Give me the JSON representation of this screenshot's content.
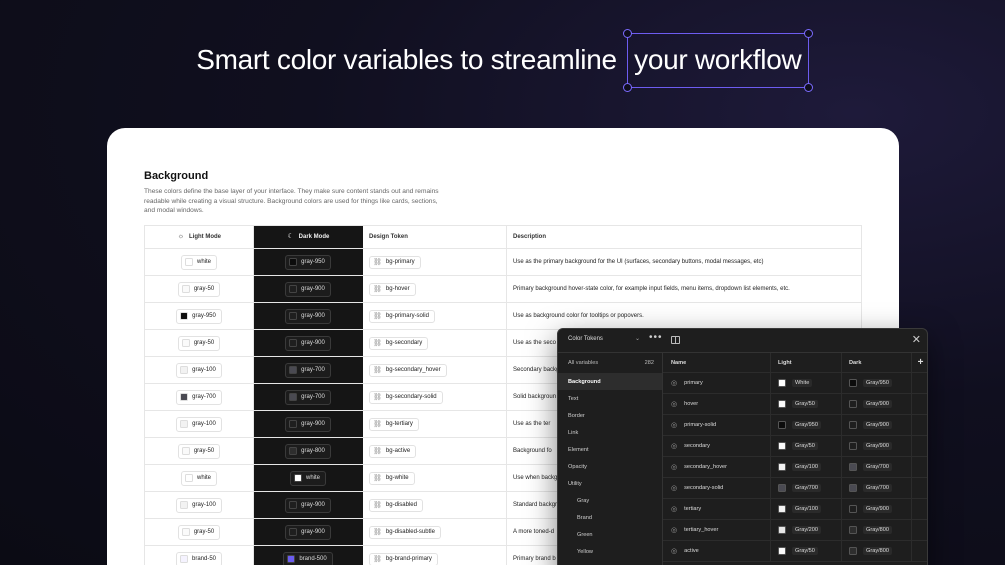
{
  "headline": {
    "before": "Smart color variables to streamline",
    "highlight": "your workflow"
  },
  "section": {
    "title": "Background",
    "description": "These colors define the base layer of your interface. They make sure content stands out and remains readable while creating a visual structure. Background colors are used for things like cards, sections, and modal windows."
  },
  "table": {
    "headers": {
      "light": "Light Mode",
      "dark": "Dark Mode",
      "token": "Design Token",
      "description": "Description"
    },
    "icons": {
      "light": "sun-icon",
      "dark": "moon-icon",
      "token": "link-icon"
    },
    "rows": [
      {
        "light": "white",
        "light_color": "#ffffff",
        "dark": "gray-950",
        "dark_color": "#0c0c0c",
        "token": "bg-primary",
        "description": "Use as the primary background for the UI (surfaces, secondary buttons, modal messages, etc)"
      },
      {
        "light": "gray-50",
        "light_color": "#fafafa",
        "dark": "gray-900",
        "dark_color": "#1f1f1f",
        "token": "bg-hover",
        "description": "Primary background hover-state color, for example input fields, menu items, dropdown list elements, etc."
      },
      {
        "light": "gray-950",
        "light_color": "#0c0c0c",
        "dark": "gray-900",
        "dark_color": "#1f1f1f",
        "token": "bg-primary-solid",
        "description": "Use as background color for tooltips or popovers."
      },
      {
        "light": "gray-50",
        "light_color": "#fafafa",
        "dark": "gray-900",
        "dark_color": "#1f1f1f",
        "token": "bg-secondary",
        "description": "Use as the seco"
      },
      {
        "light": "gray-100",
        "light_color": "#f2f2f2",
        "dark": "gray-700",
        "dark_color": "#4a4a52",
        "token": "bg-secondary_hover",
        "description": "Secondary backgr"
      },
      {
        "light": "gray-700",
        "light_color": "#4a4a52",
        "dark": "gray-700",
        "dark_color": "#4a4a52",
        "token": "bg-secondary-solid",
        "description": "Solid backgroun"
      },
      {
        "light": "gray-100",
        "light_color": "#f2f2f2",
        "dark": "gray-900",
        "dark_color": "#1f1f1f",
        "token": "bg-tertiary",
        "description": "Use as the ter"
      },
      {
        "light": "gray-50",
        "light_color": "#fafafa",
        "dark": "gray-800",
        "dark_color": "#2e2e2e",
        "token": "bg-active",
        "description": "Background fo"
      },
      {
        "light": "white",
        "light_color": "#ffffff",
        "dark": "white",
        "dark_color": "#ffffff",
        "token": "bg-white",
        "description": "Use when backg"
      },
      {
        "light": "gray-100",
        "light_color": "#f2f2f2",
        "dark": "gray-900",
        "dark_color": "#1f1f1f",
        "token": "bg-disabled",
        "description": "Standard backgr"
      },
      {
        "light": "gray-50",
        "light_color": "#fafafa",
        "dark": "gray-900",
        "dark_color": "#1f1f1f",
        "token": "bg-disabled-subtle",
        "description": "A more toned-d"
      },
      {
        "light": "brand-50",
        "light_color": "#f5f3ff",
        "dark": "brand-500",
        "dark_color": "#6b5cf0",
        "token": "bg-brand-primary",
        "description": "Primary brand b"
      }
    ]
  },
  "panel": {
    "collection": "Color Tokens",
    "icons": {
      "chevron": "chevron-down-icon",
      "more": "more-icon",
      "sidebar": "sidebar-toggle-icon",
      "close": "close-icon",
      "add": "plus-icon",
      "token": "palette-icon"
    },
    "all_label": "All variables",
    "all_count": "282",
    "groups": [
      {
        "label": "Background",
        "active": true,
        "sub": false
      },
      {
        "label": "Text",
        "active": false,
        "sub": false
      },
      {
        "label": "Border",
        "active": false,
        "sub": false
      },
      {
        "label": "Link",
        "active": false,
        "sub": false
      },
      {
        "label": "Element",
        "active": false,
        "sub": false
      },
      {
        "label": "Opacity",
        "active": false,
        "sub": false
      },
      {
        "label": "Utility",
        "active": false,
        "sub": false
      },
      {
        "label": "Gray",
        "active": false,
        "sub": true
      },
      {
        "label": "Brand",
        "active": false,
        "sub": true
      },
      {
        "label": "Green",
        "active": false,
        "sub": true
      },
      {
        "label": "Yellow",
        "active": false,
        "sub": true
      }
    ],
    "headers": {
      "name": "Name",
      "light": "Light",
      "dark": "Dark",
      "add": "+"
    },
    "rows": [
      {
        "name": "primary",
        "light": "White",
        "light_color": "#ffffff",
        "dark": "Gray/950",
        "dark_color": "#0c0c0c"
      },
      {
        "name": "hover",
        "light": "Gray/50",
        "light_color": "#fafafa",
        "dark": "Gray/900",
        "dark_color": "#1f1f1f"
      },
      {
        "name": "primary-solid",
        "light": "Gray/950",
        "light_color": "#0c0c0c",
        "dark": "Gray/900",
        "dark_color": "#1f1f1f"
      },
      {
        "name": "secondary",
        "light": "Gray/50",
        "light_color": "#fafafa",
        "dark": "Gray/900",
        "dark_color": "#1f1f1f"
      },
      {
        "name": "secondary_hover",
        "light": "Gray/100",
        "light_color": "#f2f2f2",
        "dark": "Gray/700",
        "dark_color": "#4a4a52"
      },
      {
        "name": "secondary-solid",
        "light": "Gray/700",
        "light_color": "#4a4a52",
        "dark": "Gray/700",
        "dark_color": "#4a4a52"
      },
      {
        "name": "tertiary",
        "light": "Gray/100",
        "light_color": "#f2f2f2",
        "dark": "Gray/900",
        "dark_color": "#1f1f1f"
      },
      {
        "name": "tertiary_hover",
        "light": "Gray/200",
        "light_color": "#e5e5e5",
        "dark": "Gray/800",
        "dark_color": "#2e2e2e"
      },
      {
        "name": "active",
        "light": "Gray/50",
        "light_color": "#fafafa",
        "dark": "Gray/800",
        "dark_color": "#2e2e2e"
      }
    ]
  }
}
